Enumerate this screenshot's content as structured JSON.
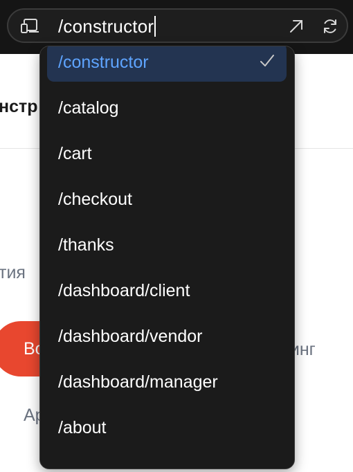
{
  "address_bar": {
    "url": "/constructor"
  },
  "background_page": {
    "heading_fragment": "нстр",
    "tab_fragment": "тия",
    "button_fragment": "Во",
    "right_text_fragment": "ринг",
    "bottom_text_fragment": "Ар"
  },
  "route_menu": {
    "selected_route": "/constructor",
    "items": [
      {
        "label": "/constructor",
        "selected": true
      },
      {
        "label": "/catalog",
        "selected": false
      },
      {
        "label": "/cart",
        "selected": false
      },
      {
        "label": "/checkout",
        "selected": false
      },
      {
        "label": "/thanks",
        "selected": false
      },
      {
        "label": "/dashboard/client",
        "selected": false
      },
      {
        "label": "/dashboard/vendor",
        "selected": false
      },
      {
        "label": "/dashboard/manager",
        "selected": false
      },
      {
        "label": "/about",
        "selected": false
      }
    ]
  },
  "colors": {
    "bar_background": "#151515",
    "menu_background": "#1b1b1b",
    "selected_background": "#233451",
    "selected_text": "#5ea4ff",
    "accent_button": "#e8472f"
  },
  "icons": [
    "devices-icon",
    "open-external-icon",
    "reload-icon",
    "check-icon"
  ]
}
